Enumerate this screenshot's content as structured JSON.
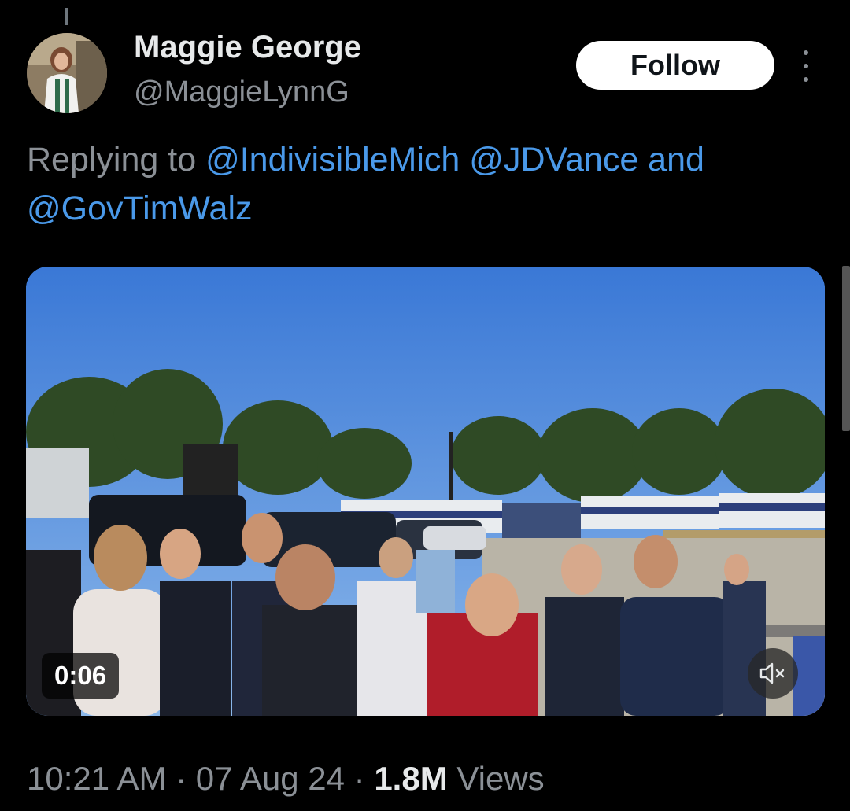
{
  "author": {
    "name": "Maggie George",
    "handle": "@MaggieLynnG"
  },
  "follow_label": "Follow",
  "reply": {
    "prefix": "Replying to ",
    "mention_1": "@IndivisibleMich",
    "mention_2": "@JDVance",
    "conjunction": " and",
    "mention_3": "@GovTimWalz"
  },
  "video": {
    "duration": "0:06",
    "muted": true
  },
  "meta": {
    "time": "10:21 AM",
    "separator": " · ",
    "date": "07 Aug 24",
    "views_count": "1.8M",
    "views_label": " Views"
  },
  "colors": {
    "accent_link": "#4a99e9",
    "secondary_text": "#8b9096",
    "background": "#000000"
  },
  "icons": [
    "avatar",
    "more-options-icon",
    "mute-icon"
  ]
}
